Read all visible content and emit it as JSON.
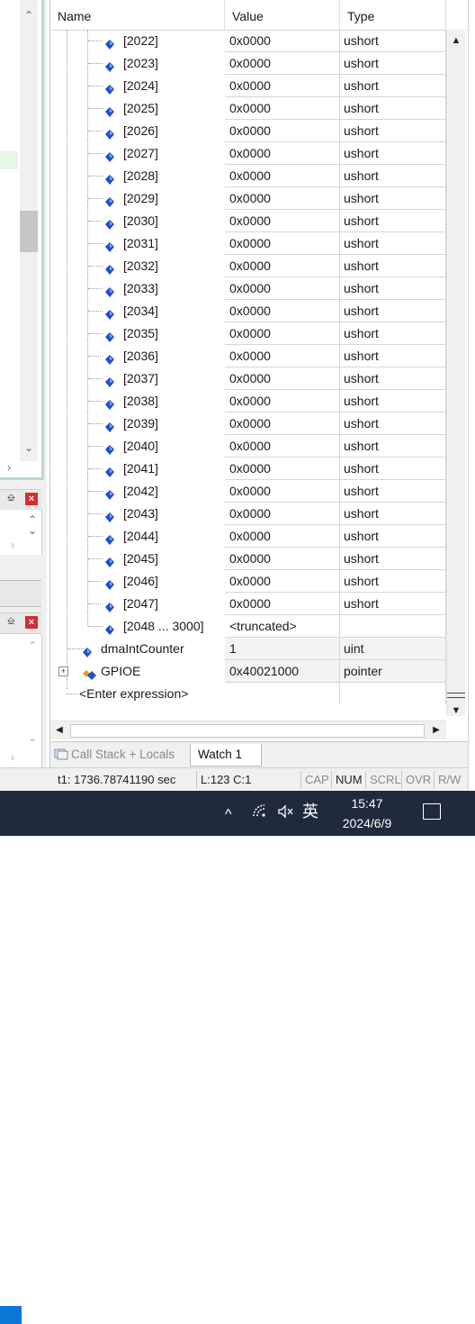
{
  "watch": {
    "columns": {
      "name": "Name",
      "value": "Value",
      "type": "Type"
    },
    "elements": [
      {
        "name": "[2022]",
        "value": "0x0000",
        "type": "ushort"
      },
      {
        "name": "[2023]",
        "value": "0x0000",
        "type": "ushort"
      },
      {
        "name": "[2024]",
        "value": "0x0000",
        "type": "ushort"
      },
      {
        "name": "[2025]",
        "value": "0x0000",
        "type": "ushort"
      },
      {
        "name": "[2026]",
        "value": "0x0000",
        "type": "ushort"
      },
      {
        "name": "[2027]",
        "value": "0x0000",
        "type": "ushort"
      },
      {
        "name": "[2028]",
        "value": "0x0000",
        "type": "ushort"
      },
      {
        "name": "[2029]",
        "value": "0x0000",
        "type": "ushort"
      },
      {
        "name": "[2030]",
        "value": "0x0000",
        "type": "ushort"
      },
      {
        "name": "[2031]",
        "value": "0x0000",
        "type": "ushort"
      },
      {
        "name": "[2032]",
        "value": "0x0000",
        "type": "ushort"
      },
      {
        "name": "[2033]",
        "value": "0x0000",
        "type": "ushort"
      },
      {
        "name": "[2034]",
        "value": "0x0000",
        "type": "ushort"
      },
      {
        "name": "[2035]",
        "value": "0x0000",
        "type": "ushort"
      },
      {
        "name": "[2036]",
        "value": "0x0000",
        "type": "ushort"
      },
      {
        "name": "[2037]",
        "value": "0x0000",
        "type": "ushort"
      },
      {
        "name": "[2038]",
        "value": "0x0000",
        "type": "ushort"
      },
      {
        "name": "[2039]",
        "value": "0x0000",
        "type": "ushort"
      },
      {
        "name": "[2040]",
        "value": "0x0000",
        "type": "ushort"
      },
      {
        "name": "[2041]",
        "value": "0x0000",
        "type": "ushort"
      },
      {
        "name": "[2042]",
        "value": "0x0000",
        "type": "ushort"
      },
      {
        "name": "[2043]",
        "value": "0x0000",
        "type": "ushort"
      },
      {
        "name": "[2044]",
        "value": "0x0000",
        "type": "ushort"
      },
      {
        "name": "[2045]",
        "value": "0x0000",
        "type": "ushort"
      },
      {
        "name": "[2046]",
        "value": "0x0000",
        "type": "ushort"
      },
      {
        "name": "[2047]",
        "value": "0x0000",
        "type": "ushort"
      }
    ],
    "truncated": {
      "name": "[2048 ... 3000]",
      "value": "<truncated>",
      "type": ""
    },
    "variables": [
      {
        "name": "dmaIntCounter",
        "value": "1",
        "type": "uint",
        "expandable": false
      },
      {
        "name": "GPIOE",
        "value": "0x40021000",
        "type": "pointer",
        "expandable": true
      }
    ],
    "enter_expression": "<Enter expression>"
  },
  "tabs": {
    "call_stack": "Call Stack + Locals",
    "watch": "Watch 1"
  },
  "status": {
    "time": "t1: 1736.78741190 sec",
    "cursor": "L:123 C:1",
    "cap": "CAP",
    "num": "NUM",
    "scrl": "SCRL",
    "ovr": "OVR",
    "rw": "R/W"
  },
  "taskbar": {
    "tray_chevron": "^",
    "ime": "英",
    "time": "15:47",
    "date": "2024/6/9"
  },
  "colors": {
    "icon_blue": "#1a4fd6",
    "selection_blue": "#0a78d7",
    "taskbar": "#1f2a3c"
  }
}
